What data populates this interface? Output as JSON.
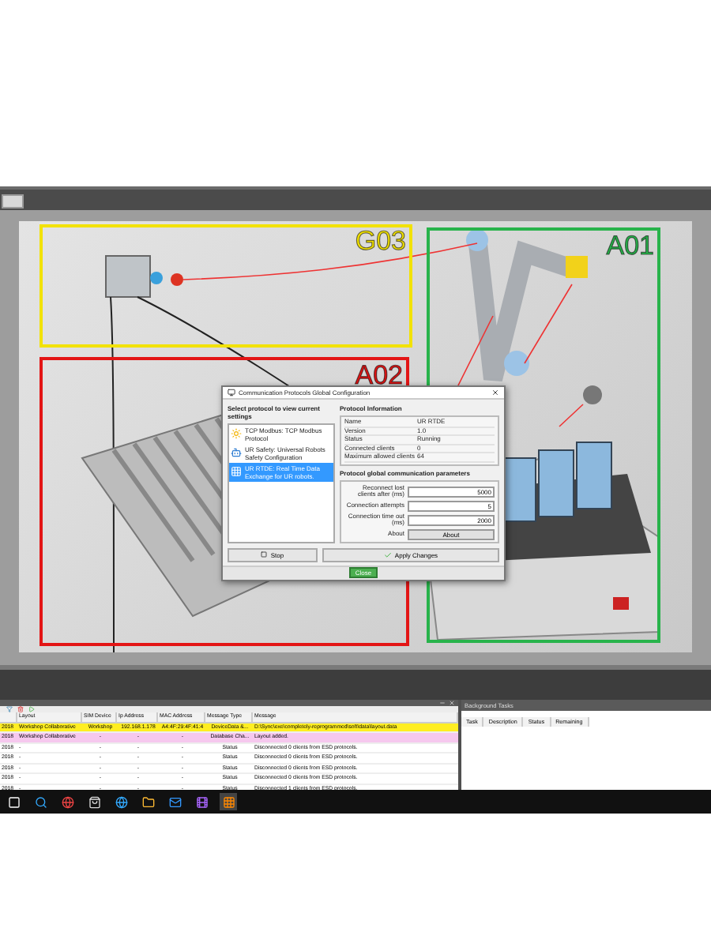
{
  "zones": [
    {
      "label": "G03",
      "color": "#f2e200"
    },
    {
      "label": "A02",
      "color": "#e31515"
    },
    {
      "label": "A01",
      "color": "#28b34b"
    }
  ],
  "dialog": {
    "title": "Communication Protocols Global Configuration",
    "list_heading": "Select protocol to view current settings",
    "protocols": [
      {
        "kind": "sun",
        "label": "TCP Modbus: TCP Modbus Protocol",
        "selected": false
      },
      {
        "kind": "robot",
        "label": "UR Safety: Universal Robots Safety Configuration",
        "selected": false
      },
      {
        "kind": "grid",
        "label": "UR RTDE: Real Time Data Exchange for UR robots.",
        "selected": true
      }
    ],
    "info_heading": "Protocol Information",
    "info": [
      {
        "label": "Name",
        "value": "UR RTDE"
      },
      {
        "label": "Version",
        "value": "1.0"
      },
      {
        "label": "Status",
        "value": "Running"
      },
      {
        "label": "Connected clients",
        "value": "0"
      },
      {
        "label": "Maximum allowed clients",
        "value": "64"
      }
    ],
    "params_heading": "Protocol global communication parameters",
    "params": [
      {
        "label": "Reconnect lost clients after (ms)",
        "value": "5000"
      },
      {
        "label": "Connection attempts",
        "value": "5"
      },
      {
        "label": "Connection time out (ms)",
        "value": "2000"
      }
    ],
    "about_label": "About",
    "about_button": "About",
    "buttons": [
      {
        "kind": "stop",
        "label": "Stop"
      },
      {
        "kind": "apply",
        "label": "Apply Changes"
      }
    ],
    "close_button": "Close"
  },
  "log": {
    "columns": [
      "",
      "Layout",
      "SIM Device",
      "Ip Address",
      "MAC Address",
      "Message Type",
      "Message"
    ],
    "rows": [
      {
        "kind": "warning",
        "cells": [
          "2018",
          "Workshop Collaborative",
          "Workshop",
          "192.168.1.178",
          "A4:4F:29:4F:41:4",
          "DeviceData &...",
          "D:\\Sync\\exe\\completely-reprogrammed\\soft\\data\\layout.data"
        ]
      },
      {
        "kind": "change",
        "cells": [
          "2018",
          "Workshop Collaborative",
          "-",
          "-",
          "-",
          "Database Cha...",
          "Layout added."
        ]
      },
      {
        "kind": "normal",
        "cells": [
          "2018",
          "-",
          "-",
          "-",
          "-",
          "Status",
          "Disconnected 0 clients from ESD protocols."
        ]
      },
      {
        "kind": "normal",
        "cells": [
          "2018",
          "-",
          "-",
          "-",
          "-",
          "Status",
          "Disconnected 0 clients from ESD protocols."
        ]
      },
      {
        "kind": "normal",
        "cells": [
          "2018",
          "-",
          "-",
          "-",
          "-",
          "Status",
          "Disconnected 0 clients from ESD protocols."
        ]
      },
      {
        "kind": "normal",
        "cells": [
          "2018",
          "-",
          "-",
          "-",
          "-",
          "Status",
          "Disconnected 0 clients from ESD protocols."
        ]
      },
      {
        "kind": "normal",
        "cells": [
          "2018",
          "-",
          "-",
          "-",
          "-",
          "Status",
          "Disconnected 1 clients from ESD protocols."
        ]
      }
    ]
  },
  "tasks": {
    "title": "Background Tasks",
    "columns": [
      "Task",
      "Description",
      "Status",
      "Remaining"
    ]
  }
}
